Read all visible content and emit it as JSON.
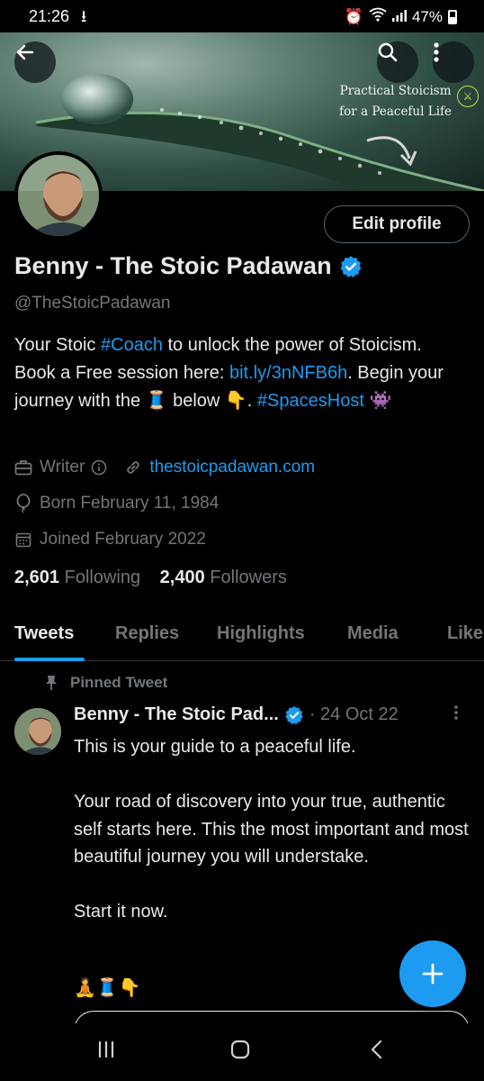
{
  "status_bar": {
    "time": "21:26",
    "battery": "47%"
  },
  "banner": {
    "line1": "Practical Stoicism",
    "line2": "for a Peaceful Life"
  },
  "profile": {
    "edit_label": "Edit profile",
    "name": "Benny - The Stoic Padawan",
    "handle": "@TheStoicPadawan",
    "bio": {
      "p1": "Your Stoic ",
      "tag1": "#Coach",
      "p2": " to unlock the power of Stoicism. Book a Free session here: ",
      "link": "bit.ly/3nNFB6h",
      "p3": ". Begin your journey with the 🧵 below 👇. ",
      "tag2": "#SpacesHost",
      "p4": " 👾"
    },
    "occupation": "Writer",
    "website": "thestoicpadawan.com",
    "birthday": "Born February 11, 1984",
    "joined": "Joined February 2022",
    "following_count": "2,601",
    "following_label": "Following",
    "followers_count": "2,400",
    "followers_label": "Followers"
  },
  "tabs": [
    "Tweets",
    "Replies",
    "Highlights",
    "Media",
    "Likes"
  ],
  "pinned_tweet": {
    "label": "Pinned Tweet",
    "author": "Benny - The Stoic Pad...",
    "date": "· 24 Oct 22",
    "body": "This is your guide to a peaceful life.\n\nYour road of discovery into your true, authentic self starts here. This the most important and most beautiful journey you will understake.\n\nStart it now.",
    "emojis": "🧘🧵👇"
  },
  "colors": {
    "accent": "#1d9bf0",
    "background": "#000000",
    "muted": "#71767b",
    "text": "#e7e9ea"
  }
}
